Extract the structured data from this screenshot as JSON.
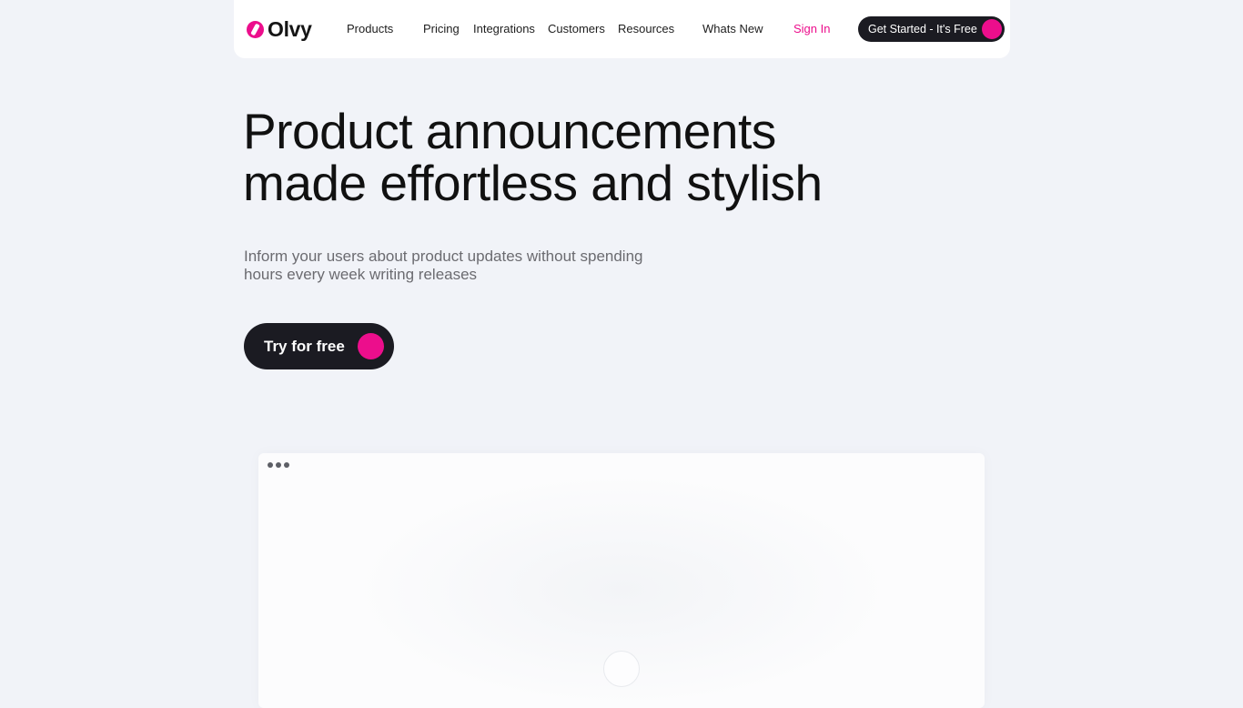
{
  "brand": {
    "name": "Olvy",
    "accent_color": "#ec0e8c",
    "dark_color": "#1b1b22",
    "background_color": "#f1f3f8"
  },
  "nav": {
    "items": [
      {
        "label": "Products"
      },
      {
        "label": "Pricing"
      },
      {
        "label": "Integrations"
      },
      {
        "label": "Customers"
      },
      {
        "label": "Resources"
      },
      {
        "label": "Whats New"
      }
    ],
    "sign_in": "Sign In",
    "cta": "Get Started - It's Free"
  },
  "hero": {
    "title_line1": "Product announcements",
    "title_line2": "made effortless and stylish",
    "subtitle_line1": "Inform your users about product updates without spending",
    "subtitle_line2": "hours every week writing releases",
    "cta": "Try for free"
  },
  "preview": {
    "window_controls": [
      "dot",
      "dot",
      "dot"
    ],
    "center_icon": "play-circle-icon"
  }
}
